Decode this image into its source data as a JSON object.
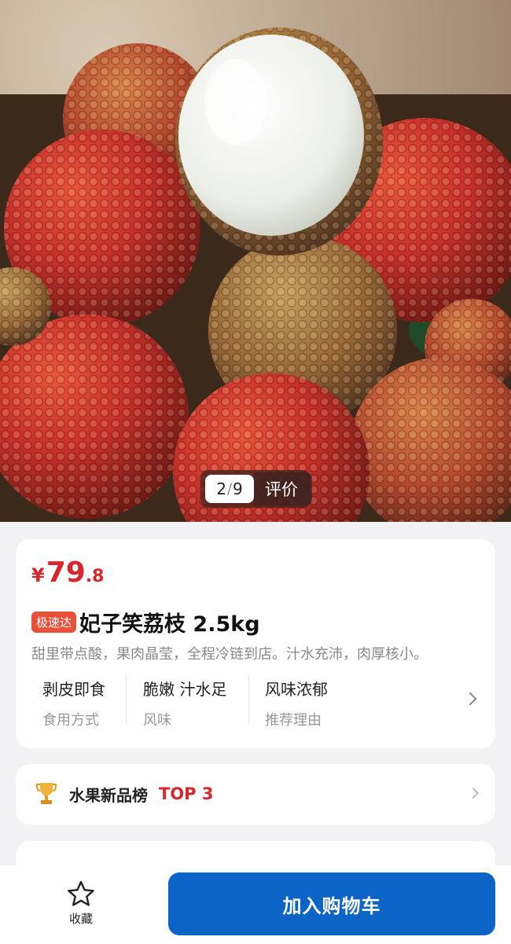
{
  "hero": {
    "pager_current": "2",
    "pager_separator": "/",
    "pager_total": "9",
    "reviews_label": "评价"
  },
  "product": {
    "price_symbol": "¥",
    "price_integer": "79",
    "price_decimal": ".8",
    "badge": "极速达",
    "title": "妃子笑荔枝 2.5kg",
    "description": "甜里带点酸，果肉晶莹，全程冷链到店。汁水充沛，肉厚核小。",
    "attributes": [
      {
        "value": "剥皮即食",
        "key": "食用方式"
      },
      {
        "value": "脆嫩 汁水足",
        "key": "风味"
      },
      {
        "value": "风味浓郁",
        "key": "推荐理由"
      }
    ]
  },
  "ranking": {
    "label": "水果新品榜",
    "position": "TOP 3"
  },
  "bottom_bar": {
    "favorite_label": "收藏",
    "add_to_cart_label": "加入购物车"
  },
  "colors": {
    "accent_red": "#d9262c",
    "primary_blue": "#0c64c7",
    "badge_orange": "#e8503a"
  },
  "icons": [
    "star-icon",
    "trophy-icon",
    "chevron-right-icon"
  ]
}
